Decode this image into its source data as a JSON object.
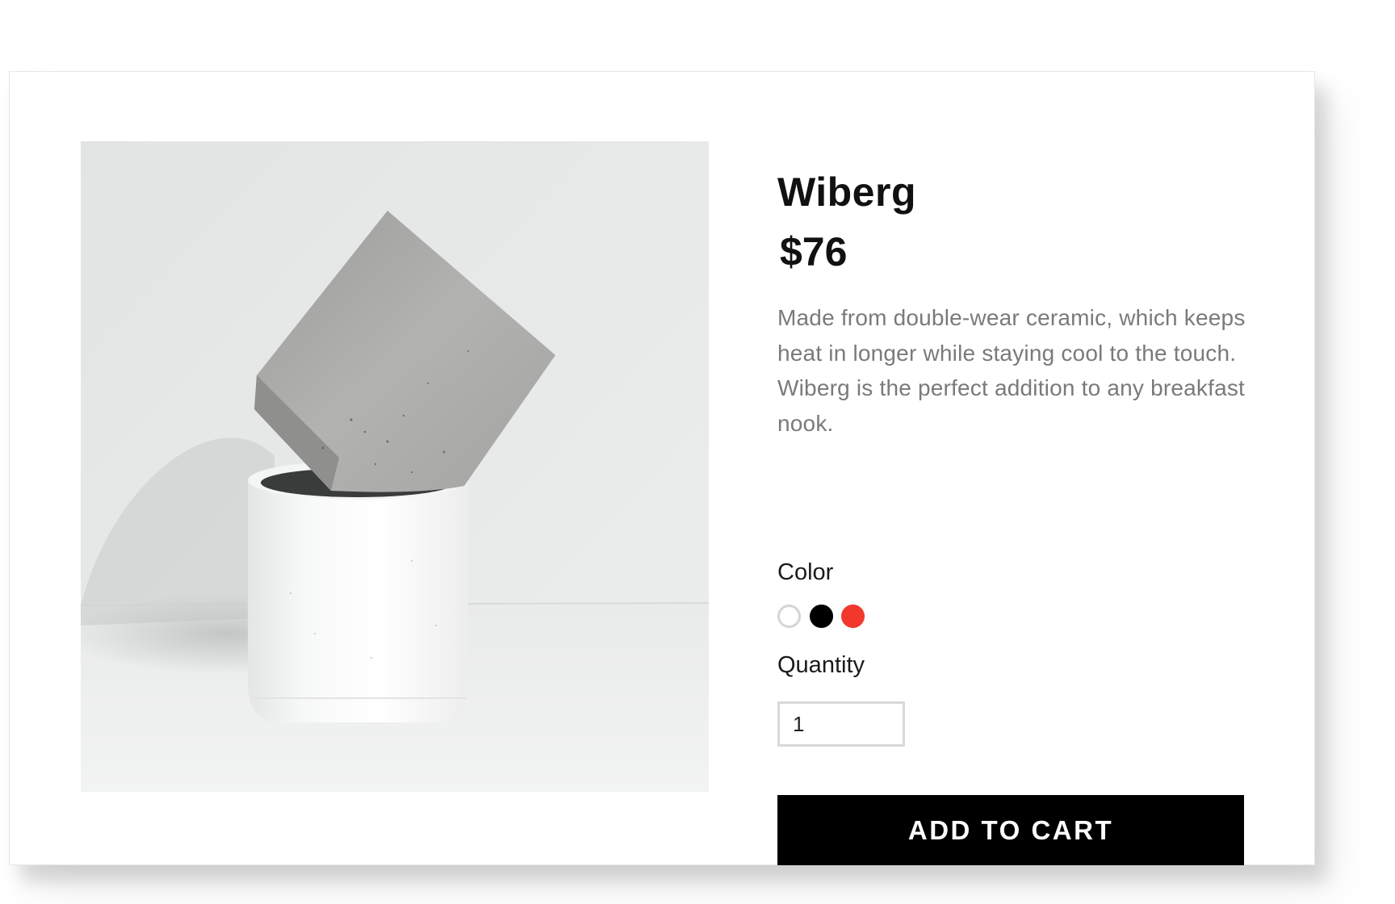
{
  "product": {
    "name": "Wiberg",
    "price": "$76",
    "description": "Made from double-wear ceramic, which keeps heat in longer while staying cool to the touch. Wiberg is the perfect addition to any breakfast nook.",
    "image_icon": "product-photo"
  },
  "color": {
    "label": "Color",
    "options": [
      {
        "name": "white",
        "hex": "#ffffff",
        "border": "#d5d5d5"
      },
      {
        "name": "black",
        "hex": "#000000",
        "border": "#000000"
      },
      {
        "name": "red",
        "hex": "#f2382d",
        "border": "#f2382d"
      }
    ]
  },
  "quantity": {
    "label": "Quantity",
    "value": "1"
  },
  "cart": {
    "button_label": "ADD TO CART"
  }
}
